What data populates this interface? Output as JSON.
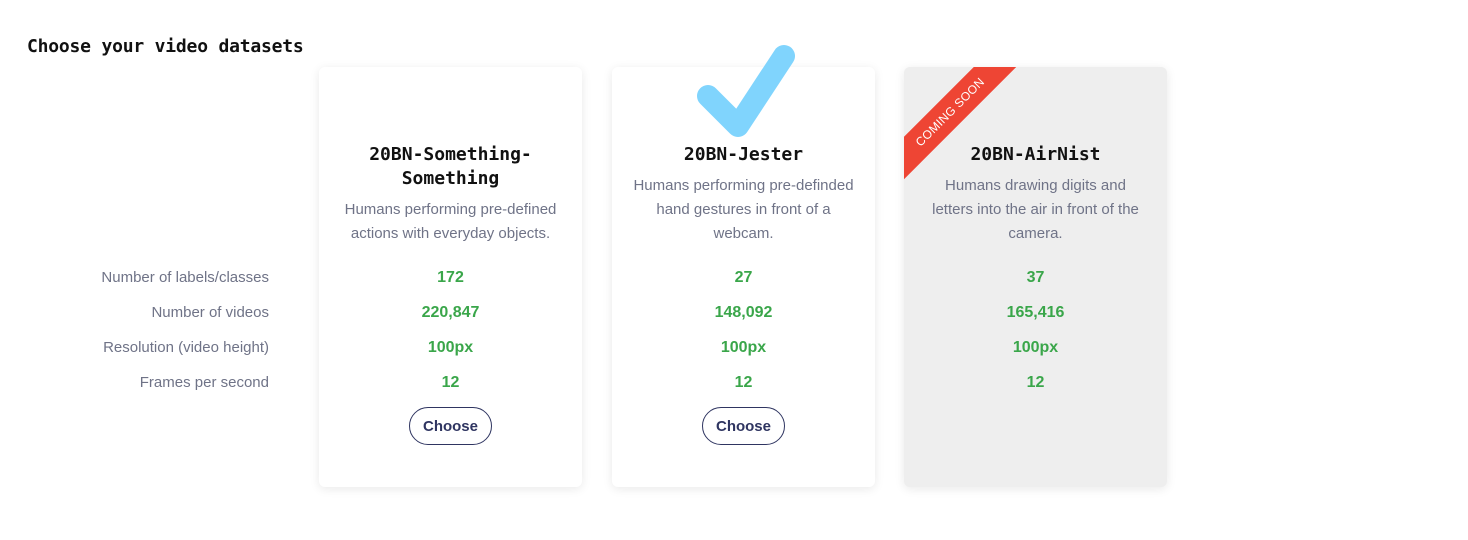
{
  "page": {
    "title": "Choose your video datasets"
  },
  "row_labels": [
    "Number of labels/classes",
    "Number of videos",
    "Resolution (video height)",
    "Frames per second"
  ],
  "datasets": [
    {
      "name": "20BN-Something-Something",
      "description": "Humans performing pre-defined actions with everyday objects.",
      "labels": "172",
      "videos": "220,847",
      "resolution": "100px",
      "fps": "12",
      "button_label": "Choose",
      "selected": false,
      "coming_soon": false
    },
    {
      "name": "20BN-Jester",
      "description": "Humans performing pre-definded hand gestures in front of a webcam.",
      "labels": "27",
      "videos": "148,092",
      "resolution": "100px",
      "fps": "12",
      "button_label": "Choose",
      "selected": true,
      "coming_soon": false
    },
    {
      "name": "20BN-AirNist",
      "description": "Humans drawing digits and letters into the air in front of the camera.",
      "labels": "37",
      "videos": "165,416",
      "resolution": "100px",
      "fps": "12",
      "ribbon_text": "COMING SOON",
      "selected": false,
      "coming_soon": true
    }
  ],
  "icons": {
    "selected": "checkmark-icon"
  },
  "colors": {
    "stat_value": "#3aa64a",
    "checkmark": "#80d4fd",
    "ribbon": "#ee4534",
    "button_border": "#2f3561",
    "muted_text": "#6f7387",
    "disabled_card": "#eeeeee"
  }
}
